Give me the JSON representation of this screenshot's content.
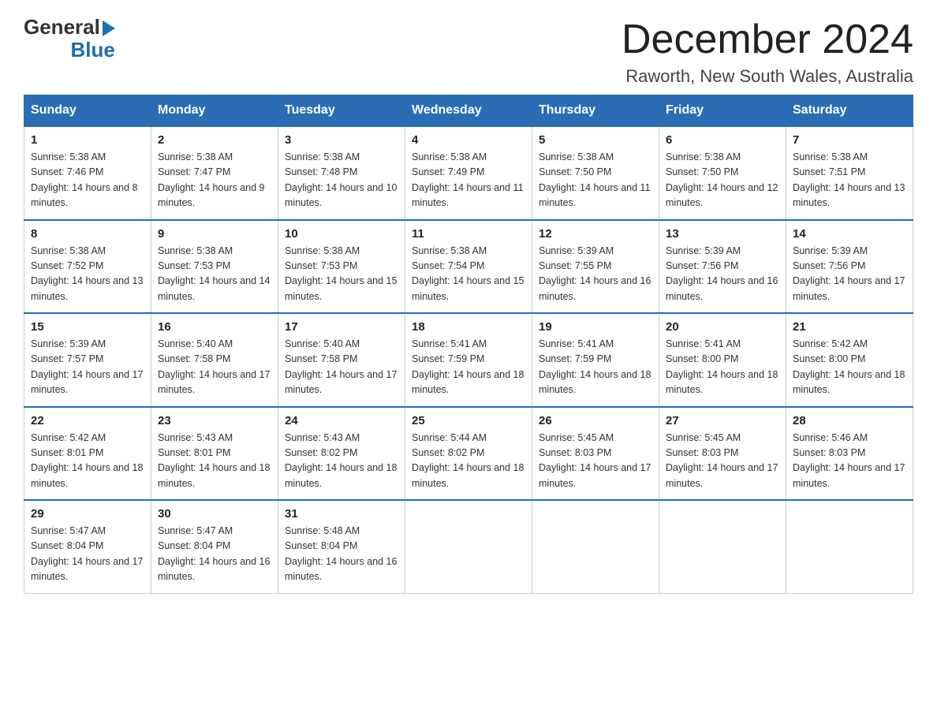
{
  "header": {
    "logo_general": "General",
    "logo_blue": "Blue",
    "title": "December 2024",
    "subtitle": "Raworth, New South Wales, Australia"
  },
  "weekdays": [
    "Sunday",
    "Monday",
    "Tuesday",
    "Wednesday",
    "Thursday",
    "Friday",
    "Saturday"
  ],
  "weeks": [
    [
      {
        "day": "1",
        "sunrise": "Sunrise: 5:38 AM",
        "sunset": "Sunset: 7:46 PM",
        "daylight": "Daylight: 14 hours and 8 minutes."
      },
      {
        "day": "2",
        "sunrise": "Sunrise: 5:38 AM",
        "sunset": "Sunset: 7:47 PM",
        "daylight": "Daylight: 14 hours and 9 minutes."
      },
      {
        "day": "3",
        "sunrise": "Sunrise: 5:38 AM",
        "sunset": "Sunset: 7:48 PM",
        "daylight": "Daylight: 14 hours and 10 minutes."
      },
      {
        "day": "4",
        "sunrise": "Sunrise: 5:38 AM",
        "sunset": "Sunset: 7:49 PM",
        "daylight": "Daylight: 14 hours and 11 minutes."
      },
      {
        "day": "5",
        "sunrise": "Sunrise: 5:38 AM",
        "sunset": "Sunset: 7:50 PM",
        "daylight": "Daylight: 14 hours and 11 minutes."
      },
      {
        "day": "6",
        "sunrise": "Sunrise: 5:38 AM",
        "sunset": "Sunset: 7:50 PM",
        "daylight": "Daylight: 14 hours and 12 minutes."
      },
      {
        "day": "7",
        "sunrise": "Sunrise: 5:38 AM",
        "sunset": "Sunset: 7:51 PM",
        "daylight": "Daylight: 14 hours and 13 minutes."
      }
    ],
    [
      {
        "day": "8",
        "sunrise": "Sunrise: 5:38 AM",
        "sunset": "Sunset: 7:52 PM",
        "daylight": "Daylight: 14 hours and 13 minutes."
      },
      {
        "day": "9",
        "sunrise": "Sunrise: 5:38 AM",
        "sunset": "Sunset: 7:53 PM",
        "daylight": "Daylight: 14 hours and 14 minutes."
      },
      {
        "day": "10",
        "sunrise": "Sunrise: 5:38 AM",
        "sunset": "Sunset: 7:53 PM",
        "daylight": "Daylight: 14 hours and 15 minutes."
      },
      {
        "day": "11",
        "sunrise": "Sunrise: 5:38 AM",
        "sunset": "Sunset: 7:54 PM",
        "daylight": "Daylight: 14 hours and 15 minutes."
      },
      {
        "day": "12",
        "sunrise": "Sunrise: 5:39 AM",
        "sunset": "Sunset: 7:55 PM",
        "daylight": "Daylight: 14 hours and 16 minutes."
      },
      {
        "day": "13",
        "sunrise": "Sunrise: 5:39 AM",
        "sunset": "Sunset: 7:56 PM",
        "daylight": "Daylight: 14 hours and 16 minutes."
      },
      {
        "day": "14",
        "sunrise": "Sunrise: 5:39 AM",
        "sunset": "Sunset: 7:56 PM",
        "daylight": "Daylight: 14 hours and 17 minutes."
      }
    ],
    [
      {
        "day": "15",
        "sunrise": "Sunrise: 5:39 AM",
        "sunset": "Sunset: 7:57 PM",
        "daylight": "Daylight: 14 hours and 17 minutes."
      },
      {
        "day": "16",
        "sunrise": "Sunrise: 5:40 AM",
        "sunset": "Sunset: 7:58 PM",
        "daylight": "Daylight: 14 hours and 17 minutes."
      },
      {
        "day": "17",
        "sunrise": "Sunrise: 5:40 AM",
        "sunset": "Sunset: 7:58 PM",
        "daylight": "Daylight: 14 hours and 17 minutes."
      },
      {
        "day": "18",
        "sunrise": "Sunrise: 5:41 AM",
        "sunset": "Sunset: 7:59 PM",
        "daylight": "Daylight: 14 hours and 18 minutes."
      },
      {
        "day": "19",
        "sunrise": "Sunrise: 5:41 AM",
        "sunset": "Sunset: 7:59 PM",
        "daylight": "Daylight: 14 hours and 18 minutes."
      },
      {
        "day": "20",
        "sunrise": "Sunrise: 5:41 AM",
        "sunset": "Sunset: 8:00 PM",
        "daylight": "Daylight: 14 hours and 18 minutes."
      },
      {
        "day": "21",
        "sunrise": "Sunrise: 5:42 AM",
        "sunset": "Sunset: 8:00 PM",
        "daylight": "Daylight: 14 hours and 18 minutes."
      }
    ],
    [
      {
        "day": "22",
        "sunrise": "Sunrise: 5:42 AM",
        "sunset": "Sunset: 8:01 PM",
        "daylight": "Daylight: 14 hours and 18 minutes."
      },
      {
        "day": "23",
        "sunrise": "Sunrise: 5:43 AM",
        "sunset": "Sunset: 8:01 PM",
        "daylight": "Daylight: 14 hours and 18 minutes."
      },
      {
        "day": "24",
        "sunrise": "Sunrise: 5:43 AM",
        "sunset": "Sunset: 8:02 PM",
        "daylight": "Daylight: 14 hours and 18 minutes."
      },
      {
        "day": "25",
        "sunrise": "Sunrise: 5:44 AM",
        "sunset": "Sunset: 8:02 PM",
        "daylight": "Daylight: 14 hours and 18 minutes."
      },
      {
        "day": "26",
        "sunrise": "Sunrise: 5:45 AM",
        "sunset": "Sunset: 8:03 PM",
        "daylight": "Daylight: 14 hours and 17 minutes."
      },
      {
        "day": "27",
        "sunrise": "Sunrise: 5:45 AM",
        "sunset": "Sunset: 8:03 PM",
        "daylight": "Daylight: 14 hours and 17 minutes."
      },
      {
        "day": "28",
        "sunrise": "Sunrise: 5:46 AM",
        "sunset": "Sunset: 8:03 PM",
        "daylight": "Daylight: 14 hours and 17 minutes."
      }
    ],
    [
      {
        "day": "29",
        "sunrise": "Sunrise: 5:47 AM",
        "sunset": "Sunset: 8:04 PM",
        "daylight": "Daylight: 14 hours and 17 minutes."
      },
      {
        "day": "30",
        "sunrise": "Sunrise: 5:47 AM",
        "sunset": "Sunset: 8:04 PM",
        "daylight": "Daylight: 14 hours and 16 minutes."
      },
      {
        "day": "31",
        "sunrise": "Sunrise: 5:48 AM",
        "sunset": "Sunset: 8:04 PM",
        "daylight": "Daylight: 14 hours and 16 minutes."
      },
      null,
      null,
      null,
      null
    ]
  ]
}
